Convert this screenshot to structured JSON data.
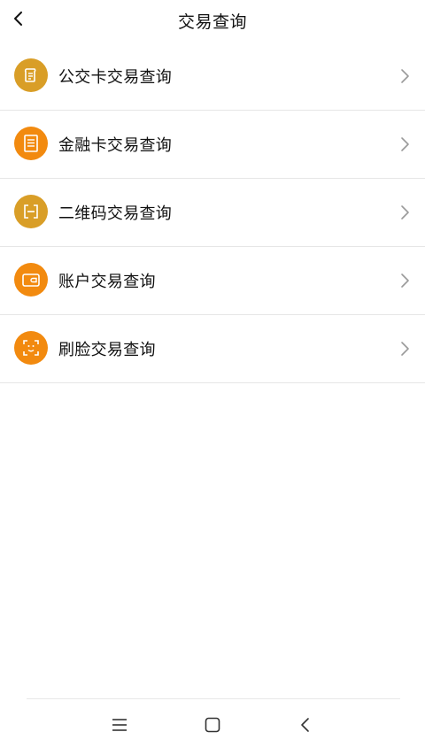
{
  "header": {
    "title": "交易查询"
  },
  "items": [
    {
      "label": "公交卡交易查询",
      "icon": "bus-card-ticket-icon",
      "color": "#D99E27"
    },
    {
      "label": "金融卡交易查询",
      "icon": "receipt-icon",
      "color": "#F28A0F"
    },
    {
      "label": "二维码交易查询",
      "icon": "qr-scan-icon",
      "color": "#D99E27"
    },
    {
      "label": "账户交易查询",
      "icon": "wallet-icon",
      "color": "#F28A0F"
    },
    {
      "label": "刷脸交易查询",
      "icon": "face-scan-icon",
      "color": "#F28A0F"
    }
  ],
  "nav": {
    "buttons": [
      "menu-icon",
      "home-square-icon",
      "back-triangle-icon"
    ]
  }
}
